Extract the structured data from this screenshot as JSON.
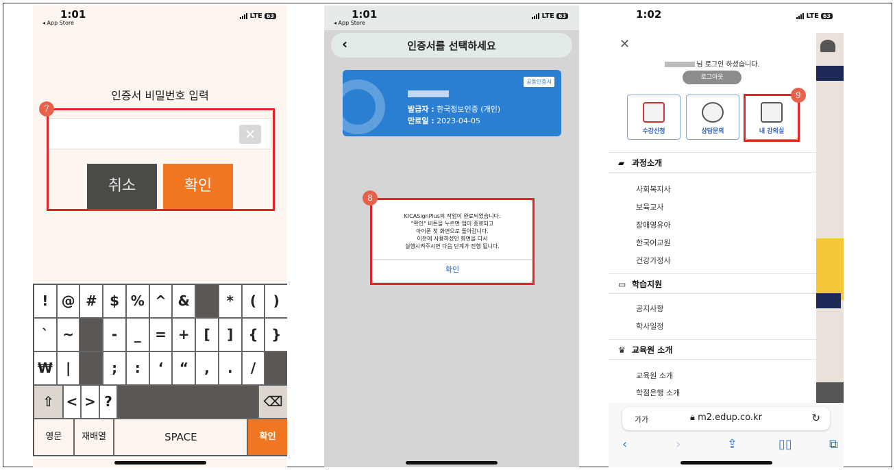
{
  "phone1": {
    "time": "1:01",
    "back_app": "◂ App Store",
    "carrier": "LTE",
    "battery": "63",
    "title": "인증서 비밀번호 입력",
    "clear_icon": "✕",
    "cancel_label": "취소",
    "confirm_label": "확인",
    "step": "7",
    "keyboard": {
      "row1": [
        "!",
        "@",
        "#",
        "$",
        "%",
        "^",
        "&",
        "",
        "*",
        "(",
        ")"
      ],
      "row2": [
        "`",
        "~",
        "",
        "-",
        "_",
        "=",
        "+",
        "[",
        "]",
        "{",
        "}"
      ],
      "row3": [
        "₩",
        "|",
        "",
        ";",
        ":",
        "‘",
        "“",
        ",",
        ".",
        "/",
        ""
      ],
      "row4_left": [
        "⇧",
        "<",
        ">",
        "?"
      ],
      "backspace_icon": "⌫",
      "bottom": [
        "영문",
        "재배열",
        "SPACE",
        "확인"
      ]
    }
  },
  "phone2": {
    "time": "1:01",
    "back_app": "◂ App Store",
    "carrier": "LTE",
    "battery": "63",
    "back_icon": "‹",
    "title": "인증서를 선택하세요",
    "cert": {
      "tag": "공동인증서",
      "issuer_label": "발급자 :",
      "issuer": "한국정보인증 (개인)",
      "expiry_label": "만료일 :",
      "expiry": "2023-04-05"
    },
    "dialog": {
      "message": "KICASignPlus의 작업이 완료되었습니다.\n\"확인\" 버튼을 누르면 앱이 종료되고\n아이폰 첫 화면으로 돌아갑니다.\n이전에 사용하셨던 화면을 다시\n실행시켜주시면 다음 단계가 진행 됩니다.",
      "ok": "확인"
    },
    "step": "8"
  },
  "phone3": {
    "time": "1:02",
    "carrier": "LTE",
    "battery": "63",
    "close_icon": "✕",
    "login_msg": "님 로그인 하셨습니다.",
    "logout": "로그아웃",
    "quick": [
      "수강신청",
      "상담문의",
      "내 강의실"
    ],
    "step": "9",
    "sections": [
      {
        "title": "과정소개",
        "icon": "book-icon",
        "items": [
          "사회복지사",
          "보육교사",
          "장애영유아",
          "한국어교원",
          "건강가정사"
        ]
      },
      {
        "title": "학습지원",
        "icon": "laptop-icon",
        "items": [
          "공지사항",
          "학사일정"
        ]
      },
      {
        "title": "교육원 소개",
        "icon": "trophy-icon",
        "items": [
          "교육원 소개",
          "학점은행 소개"
        ]
      }
    ],
    "safari": {
      "aa": "가가",
      "url": "m2.edup.co.kr"
    }
  }
}
